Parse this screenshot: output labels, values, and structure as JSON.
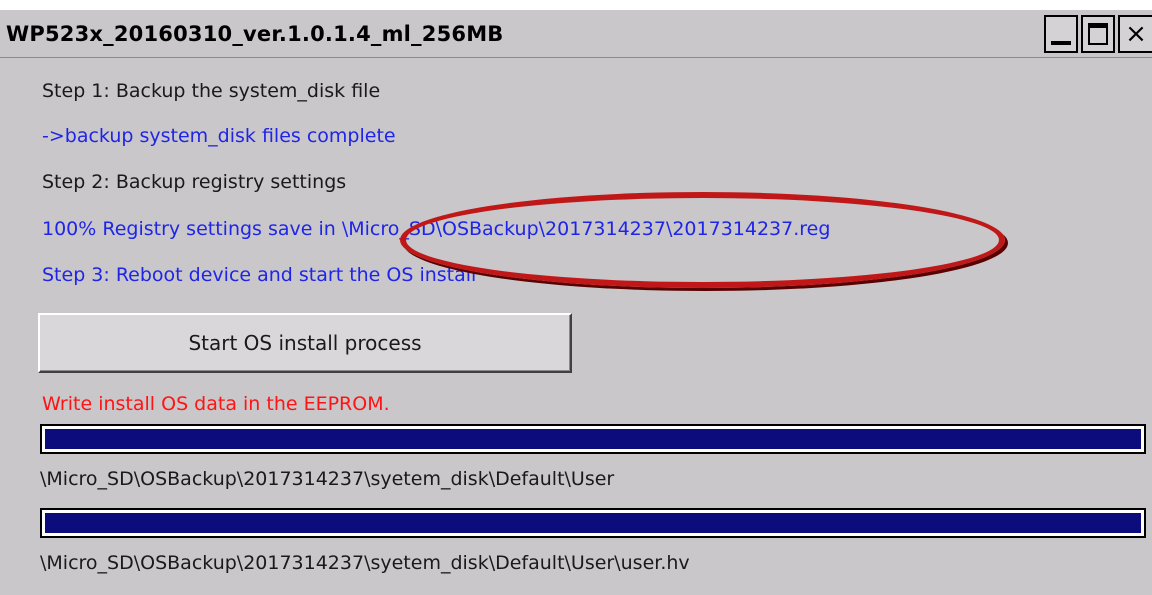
{
  "window": {
    "title": "WP523x_20160310_ver.1.0.1.4_ml_256MB",
    "buttons": {
      "minimize": "minimize-icon",
      "maximize": "maximize-icon",
      "close": "×"
    }
  },
  "steps": {
    "step1": "Step 1: Backup the system_disk file",
    "step1_status": "->backup system_disk files complete",
    "step2": "Step 2: Backup registry settings",
    "step2_status": "100% Registry settings save in \\Micro_SD\\OSBackup\\2017314237\\2017314237.reg",
    "step3": "Step 3: Reboot device and start the OS install"
  },
  "actions": {
    "start_button": "Start OS install process"
  },
  "status": {
    "message": "Write install OS data in the EEPROM.",
    "progress1": {
      "value": 1.0,
      "path": "\\Micro_SD\\OSBackup\\2017314237\\syetem_disk\\Default\\User"
    },
    "progress2": {
      "value": 1.0,
      "path": "\\Micro_SD\\OSBackup\\2017314237\\syetem_disk\\Default\\User\\user.hv"
    }
  },
  "colors": {
    "window_bg": "#c9c7c9",
    "text_blue": "#1f25e8",
    "text_red": "#ff1414",
    "progress_fill": "#0c0c7c",
    "annotation_red": "#c01818"
  }
}
